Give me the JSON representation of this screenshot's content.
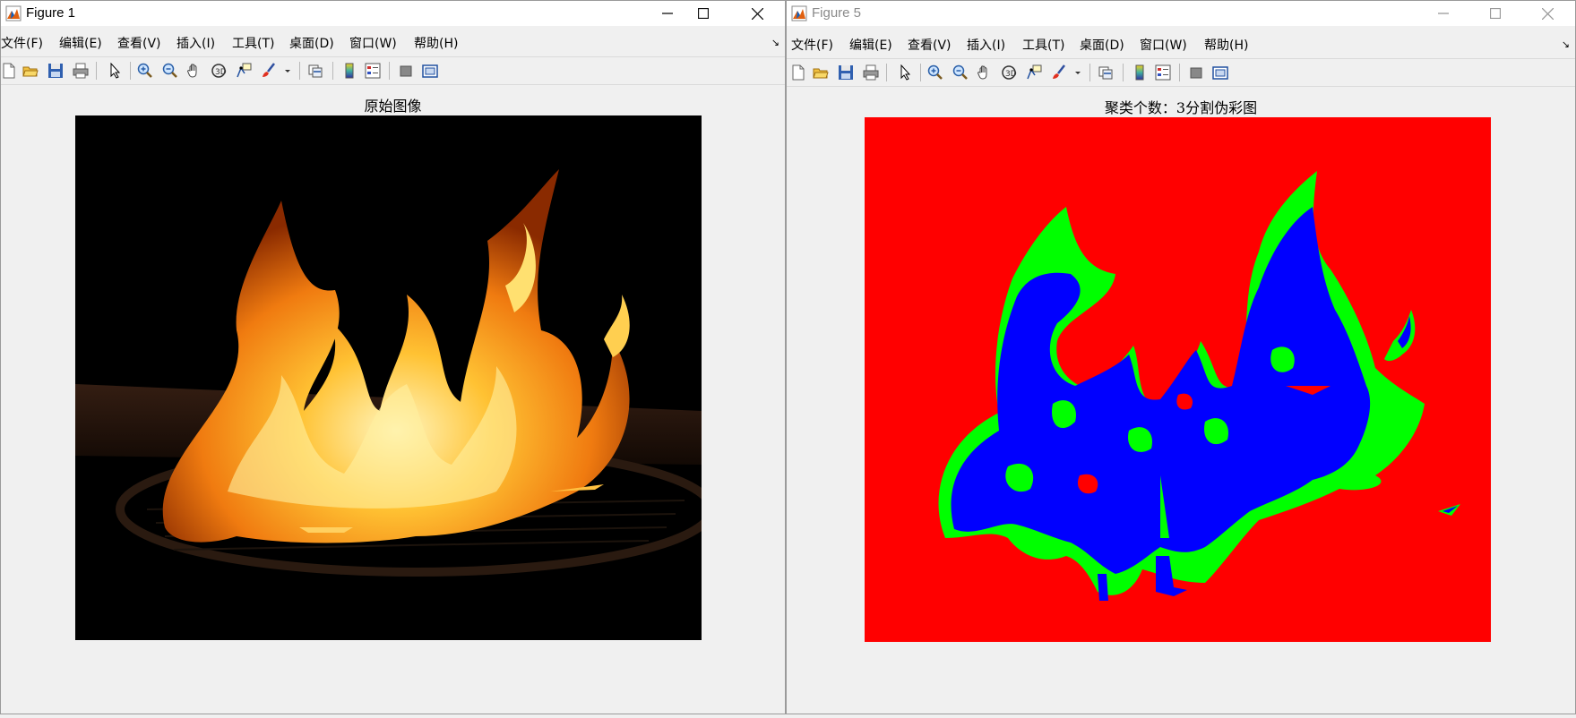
{
  "figure1": {
    "title": "Figure 1",
    "menu": [
      "文件(F)",
      "编辑(E)",
      "查看(V)",
      "插入(I)",
      "工具(T)",
      "桌面(D)",
      "窗口(W)",
      "帮助(H)"
    ],
    "axes_title": "原始图像",
    "image": "flames"
  },
  "figure5": {
    "title": "Figure 5",
    "menu": [
      "文件(F)",
      "编辑(E)",
      "查看(V)",
      "插入(I)",
      "工具(T)",
      "桌面(D)",
      "窗口(W)",
      "帮助(H)"
    ],
    "axes_title": "聚类个数：3分割伪彩图",
    "image": "segmentation",
    "colors": {
      "background": "#ff0000",
      "cluster2": "#00ff00",
      "cluster3": "#0000ff"
    }
  },
  "toolbar_icons": [
    "new-file-icon",
    "open-folder-icon",
    "save-icon",
    "print-icon",
    "select-arrow-icon",
    "zoom-in-icon",
    "zoom-out-icon",
    "pan-hand-icon",
    "rotate-3d-icon",
    "data-cursor-icon",
    "brush-icon",
    "dropdown-arrow-icon",
    "link-plot-icon",
    "colorbar-icon",
    "legend-icon",
    "hide-plot-tools-icon",
    "show-plot-tools-icon"
  ]
}
